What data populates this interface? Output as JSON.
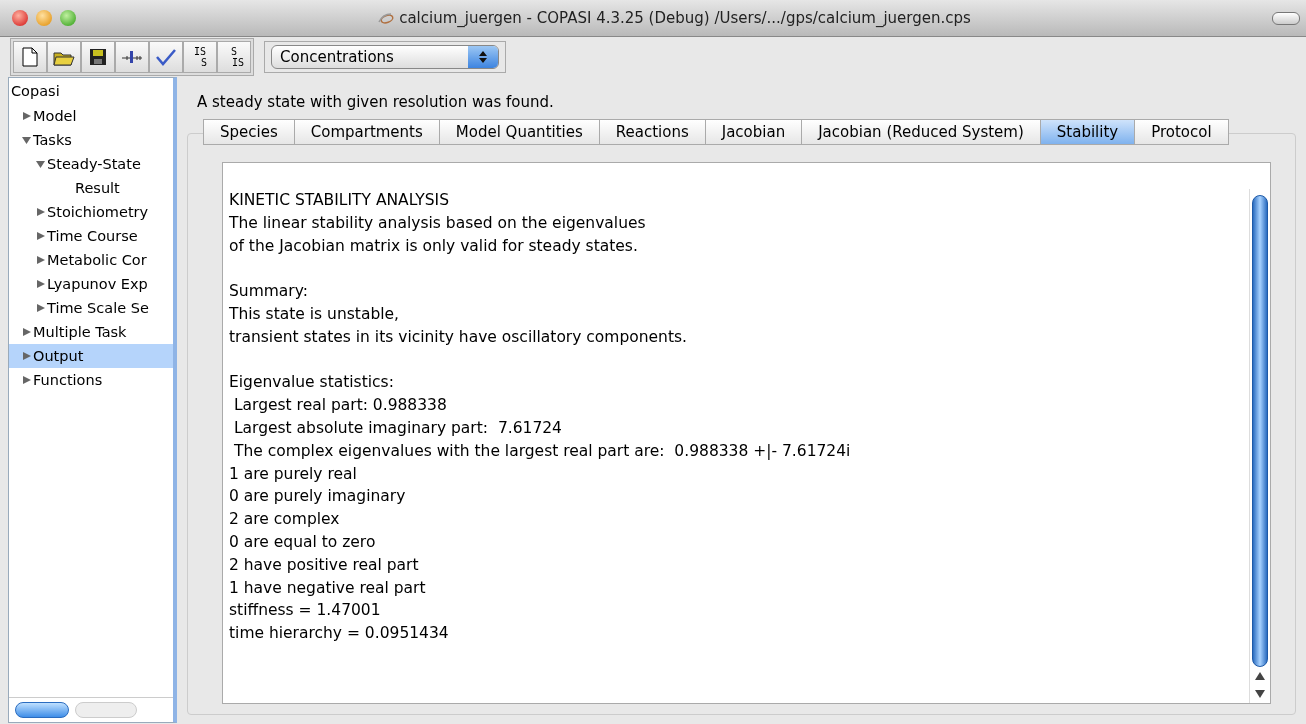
{
  "window": {
    "title": "calcium_juergen - COPASI 4.3.25 (Debug) /Users/.../gps/calcium_juergen.cps"
  },
  "toolbar": [
    {
      "kind": "new"
    },
    {
      "kind": "open"
    },
    {
      "kind": "save"
    },
    {
      "kind": "slider"
    },
    {
      "kind": "check"
    },
    {
      "kind": "transfer",
      "top": "IS",
      "bottom": "S"
    },
    {
      "kind": "transfer",
      "top": "S",
      "bottom": "IS"
    }
  ],
  "unit_select": {
    "value": "Concentrations"
  },
  "tree": {
    "root": "Copasi",
    "items": [
      {
        "label": "Model",
        "expanded": false,
        "selected": false
      },
      {
        "label": "Tasks",
        "expanded": true,
        "selected": false,
        "children": [
          {
            "label": "Steady-State",
            "expanded": true,
            "selected": false,
            "children": [
              {
                "label": "Result",
                "selected": false
              }
            ]
          },
          {
            "label": "Stoichiometry",
            "expanded": false,
            "selected": false
          },
          {
            "label": "Time Course",
            "expanded": false,
            "selected": false
          },
          {
            "label": "Metabolic Cor",
            "expanded": false,
            "selected": false
          },
          {
            "label": "Lyapunov Exp",
            "expanded": false,
            "selected": false
          },
          {
            "label": "Time Scale Se",
            "expanded": false,
            "selected": false
          }
        ]
      },
      {
        "label": "Multiple Task",
        "expanded": false,
        "selected": false
      },
      {
        "label": "Output",
        "expanded": false,
        "selected": true
      },
      {
        "label": "Functions",
        "expanded": false,
        "selected": false
      }
    ]
  },
  "status_message": "A steady state with given resolution was found.",
  "tabs": [
    {
      "label": "Species",
      "selected": false
    },
    {
      "label": "Compartments",
      "selected": false
    },
    {
      "label": "Model Quantities",
      "selected": false
    },
    {
      "label": "Reactions",
      "selected": false
    },
    {
      "label": "Jacobian",
      "selected": false
    },
    {
      "label": "Jacobian (Reduced System)",
      "selected": false
    },
    {
      "label": "Stability",
      "selected": true
    },
    {
      "label": "Protocol",
      "selected": false
    }
  ],
  "report": {
    "paragraphs": [
      [
        "KINETIC STABILITY ANALYSIS",
        "The linear stability analysis based on the eigenvalues",
        "of the Jacobian matrix is only valid for steady states."
      ],
      [
        "Summary:",
        "This state is unstable,",
        "transient states in its vicinity have oscillatory components."
      ],
      [
        "Eigenvalue statistics:",
        " Largest real part: 0.988338",
        " Largest absolute imaginary part:  7.61724",
        " The complex eigenvalues with the largest real part are:  0.988338 +|- 7.61724i",
        "1 are purely real",
        "0 are purely imaginary",
        "2 are complex",
        "0 are equal to zero",
        "2 have positive real part",
        "1 have negative real part",
        "stiffness = 1.47001",
        "time hierarchy = 0.0951434"
      ]
    ]
  }
}
